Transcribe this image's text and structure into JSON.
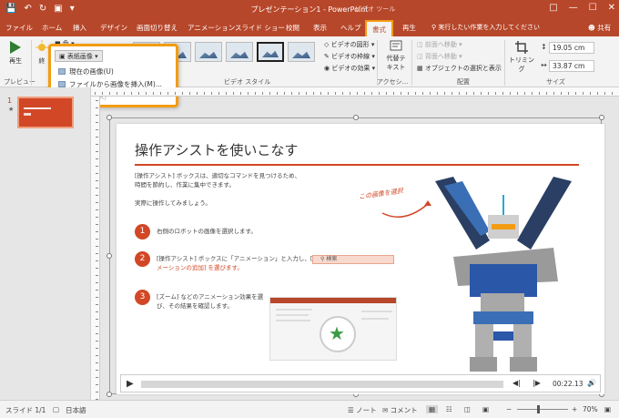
{
  "window": {
    "title": "プレゼンテーション1 - PowerPoint",
    "context_tool": "ビデオ ツール",
    "qat": [
      "save",
      "undo",
      "redo",
      "present"
    ],
    "win_buttons": [
      "restore",
      "minimize",
      "maximize",
      "close"
    ]
  },
  "tabs": [
    "ファイル",
    "ホーム",
    "挿入",
    "デザイン",
    "画面切り替え",
    "アニメーション",
    "スライド ショー",
    "校閲",
    "表示",
    "ヘルプ",
    "書式",
    "再生"
  ],
  "active_tab": "書式",
  "tell_me": "実行したい作業を入力してください",
  "share": "共有",
  "ribbon": {
    "preview_label": "再生",
    "preview_group": "プレビュー",
    "end_label": "終",
    "color_label": "色",
    "poster_label": "表紙画像",
    "video_styles_group": "ビデオ スタイル",
    "video_shape": "ビデオの図形",
    "video_border": "ビデオの枠線",
    "video_effects": "ビデオの効果",
    "accessibility_group": "アクセシ...",
    "alt_text_line1": "代替テ",
    "alt_text_line2": "キスト",
    "arrange_group": "配置",
    "bring_forward": "前面へ移動",
    "send_backward": "背面へ移動",
    "selection_pane": "オブジェクトの選択と表示",
    "crop_label": "トリミング",
    "size_group": "サイズ",
    "height_value": "19.05 cm",
    "width_value": "33.87 cm"
  },
  "poster_menu": {
    "button_label": "表紙画像",
    "items": [
      {
        "label": "現在の画像(U)",
        "enabled": true
      },
      {
        "label": "ファイルから画像を挿入(M)...",
        "enabled": true
      },
      {
        "label": "リセット(R)",
        "enabled": false
      }
    ]
  },
  "thumbnail": {
    "number": "1",
    "star": "★"
  },
  "slide": {
    "title": "操作アシストを使いこなす",
    "intro_line1": "[操作アシスト] ボックスは、適切なコマンドを見つけるため、",
    "intro_line2": "時間を節約し、作業に集中できます。",
    "try_line": "実際に操作してみましょう。",
    "steps": [
      {
        "num": "1",
        "line1": "右側のロボットの画像を選択します。",
        "line2": ""
      },
      {
        "num": "2",
        "line1": "[操作アシスト] ボックスに「アニメーション」と入力し、[アニ",
        "line2": "メーションの追加] を選びます。"
      },
      {
        "num": "3",
        "line1": "[ズーム] などのアニメーション効果を選",
        "line2": "び、その結果を確認します。"
      }
    ],
    "search_text": "検索",
    "annotation": "この画像を選択"
  },
  "video": {
    "time": "00:22.13",
    "progress": 0.0
  },
  "statusbar": {
    "slide": "スライド 1/1",
    "language": "日本語",
    "notes": "ノート",
    "comments": "コメント",
    "zoom": "70%"
  },
  "colors": {
    "accent": "#b7472a",
    "highlight": "#f39c12",
    "slide_red": "#d24726"
  }
}
